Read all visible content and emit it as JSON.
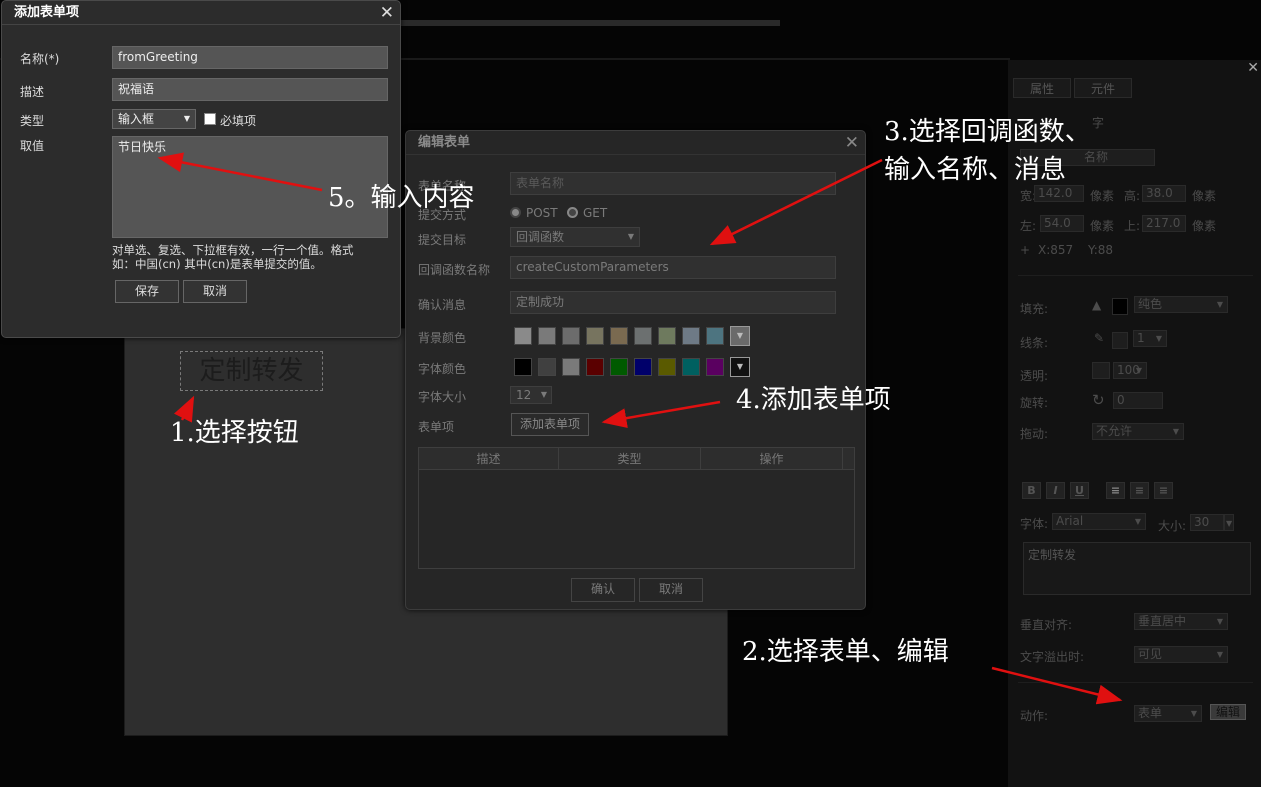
{
  "canvas": {
    "button_text": "定制转发"
  },
  "panel": {
    "tabs": [
      "属性",
      "元件"
    ],
    "subtab": "字",
    "name_field": "名称",
    "width_label": "宽:",
    "width_value": "142.0",
    "height_label": "高:",
    "height_value": "38.0",
    "left_label": "左:",
    "left_value": "54.0",
    "top_label": "上:",
    "top_value": "217.0",
    "unit": "像素",
    "plus": "+",
    "coord_x": "X:857",
    "coord_y": "Y:88",
    "fill_label": "填充:",
    "fill_value": "纯色",
    "stroke_label": "线条:",
    "stroke_value": "1",
    "opacity_label": "透明:",
    "opacity_value": "100",
    "rotate_label": "旋转:",
    "rotate_value": "0",
    "drag_label": "拖动:",
    "drag_value": "不允许",
    "bold": "B",
    "italic": "I",
    "underline": "U",
    "font_label": "字体:",
    "font_value": "Arial",
    "size_label": "大小:",
    "size_value": "30",
    "text_value": "定制转发",
    "valign_label": "垂直对齐:",
    "valign_value": "垂直居中",
    "overflow_label": "文字溢出时:",
    "overflow_value": "可见",
    "action_label": "动作:",
    "action_value": "表单",
    "edit_button": "编辑"
  },
  "edit_dialog": {
    "title": "编辑表单",
    "form_name_label": "表单名称",
    "form_name_placeholder": "表单名称",
    "submit_method_label": "提交方式",
    "method_post": "POST",
    "method_get": "GET",
    "submit_target_label": "提交目标",
    "submit_target_value": "回调函数",
    "callback_label": "回调函数名称",
    "callback_value": "createCustomParameters",
    "confirm_msg_label": "确认消息",
    "confirm_msg_value": "定制成功",
    "bg_color_label": "背景颜色",
    "bg_colors": [
      "#8a8a8a",
      "#7a7a7a",
      "#6c6c6c",
      "#77745f",
      "#7a6a50",
      "#6c7070",
      "#6e7a5e",
      "#6e7a86",
      "#4d7480"
    ],
    "font_color_label": "字体颜色",
    "font_colors": [
      "#000000",
      "#404040",
      "#7a7a7a",
      "#5a0000",
      "#005a00",
      "#00006a",
      "#5a5a00",
      "#006060",
      "#5a0060"
    ],
    "font_size_label": "字体大小",
    "font_size_value": "12",
    "form_items_label": "表单项",
    "add_item_button": "添加表单项",
    "table_headers": [
      "描述",
      "类型",
      "操作"
    ],
    "ok_button": "确认",
    "cancel_button": "取消"
  },
  "add_dialog": {
    "title": "添加表单项",
    "name_label": "名称(*)",
    "name_value": "fromGreeting",
    "desc_label": "描述",
    "desc_value": "祝福语",
    "type_label": "类型",
    "type_value": "输入框",
    "required_label": "必填项",
    "value_label": "取值",
    "value_text": "节日快乐",
    "hint_line1": "对单选、复选、下拉框有效，一行一个值。格式",
    "hint_line2": "如：中国(cn) 其中(cn)是表单提交的值。",
    "save_button": "保存",
    "cancel_button": "取消"
  },
  "annotations": {
    "step1": "1.选择按钮",
    "step2": "2.选择表单、编辑",
    "step3_line1": "3.选择回调函数、",
    "step3_line2": "输入名称、消息",
    "step4": "4.添加表单项",
    "step5": "5。输入内容"
  },
  "colors": {
    "arrow": "#e01010",
    "dialog_bg": "#2c2c2c"
  }
}
